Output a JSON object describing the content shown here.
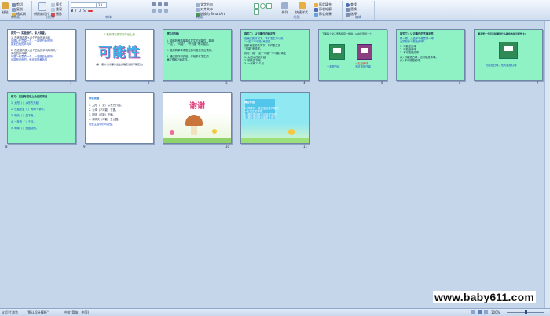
{
  "ribbon": {
    "clipboard_paste": "粘贴",
    "clipboard_items": [
      "剪切",
      "复制",
      "格式刷"
    ],
    "slides_new": "新建幻灯片",
    "slides_items": [
      "版式",
      "重设",
      "删除"
    ],
    "font_name": "",
    "font_size": "24",
    "paragraph_items": [
      "文字方向",
      "对齐文本",
      "转换为 SmartArt"
    ],
    "drawing_arrange": "排列",
    "drawing_quick_styles": "快速样式",
    "drawing_items": [
      "形状填充",
      "形状轮廓",
      "形状效果"
    ],
    "editing_items": [
      "查找",
      "替换",
      "选择"
    ],
    "group_labels": [
      "剪贴板",
      "幻灯片",
      "字体",
      "段落",
      "绘图",
      "编辑"
    ]
  },
  "slides": [
    {
      "num": "1",
      "title": "探究一：实验操作，深入调查。",
      "lines": [
        "1. 在纸箱内放入几个白色的乒乓球",
        "问题1:任意摸一个，一定是白色的吗?",
        "摸到白色的乒乓球",
        "2. 在纸箱内放入几个白色的乒乓球和几个",
        "黄色的乒乓球",
        "问题2:任意摸一个，一定是白色的吗?",
        "可能是白色的，也可能是黄色的"
      ]
    },
    {
      "num": "2",
      "subtitle": "人教新课标数学四年级上册",
      "big": "可能性",
      "caption": "(第一课时:认识事件发生的确定性和不确定性)"
    },
    {
      "num": "3",
      "title": "学习目标",
      "lines": [
        "1. 能够判断简单事件发生的可能性，能用",
        "“一定”、“可能”、“不可能”等词描述。",
        "2. 能对简单事件发生的可能性作出预测。",
        "3. 通过操作和实验，体验事件发生的",
        "确定性和不确定性。"
      ]
    },
    {
      "num": "4",
      "title": "探究二：认识事件的确定性",
      "lines": [
        "在确定的情况下，事件发生可以用",
        "“一定”“不可能”来描述。",
        "在不确定的情况下，事件发生用",
        "“可能”来描述。",
        "练习：用“一定”“可能”“不可能”填空",
        "1. 太阳从西边升起",
        "2. 明天会下雨",
        "3. 一年有12个月"
      ]
    },
    {
      "num": "5",
      "title": "下面每个盒子里各装有一些球，从中任意摸一个，",
      "labels": [
        "一定是白球",
        "一定是黄球",
        "不可能是白球"
      ]
    },
    {
      "num": "6",
      "title": "探究三：认识事件的不确定性",
      "lines": [
        "想一想，从盒子中任意摸一球，",
        "会摸到什么颜色的球?",
        "1. 可能是白球",
        "2. 可能是黄球",
        "3. 不可能是红球",
        "(1) 可能是白球，也可能是黄球。",
        "(2) 不可能是红球。"
      ]
    },
    {
      "num": "7",
      "title": "摸手里一个乒乓球摸到什么颜色的球可能性大?",
      "lines": [
        "可能是白球，也可能是红球"
      ]
    },
    {
      "num": "8",
      "title": "练习：在括号里填上合适的词语",
      "lines": [
        "1. 太阳（ ）从东方升起。",
        "2. 在抽屉里（ ）有两个硬币。",
        "3. 明天（ ）会下雨。",
        "4. 一年有（ ）个月。",
        "5. 地球（ ）是运动的。"
      ]
    },
    {
      "num": "9",
      "title": "你说我填",
      "lines": [
        "1. 太阳（一定）从东方升起。",
        "2. 公鸡（不可能）下蛋。",
        "3. 明天（可能）下雨。",
        "4. 我明天（可能）去公园。",
        "说说生活中的可能性。"
      ]
    },
    {
      "num": "10",
      "title": "谢谢",
      "lines": []
    },
    {
      "num": "11",
      "title": "课后作业",
      "lines": [
        "1. 同学们，说说生活中有哪些",
        "一定发生的事情。",
        "2. 哪些事情是不可能发生的?",
        "3. 哪些事情是可能发生的?"
      ]
    }
  ],
  "status": {
    "slide_info": "幻灯片浏览",
    "theme": "\"默认设计模板\"",
    "lang": "中文(简体，中国)",
    "zoom": "100%"
  },
  "watermark": "www.baby611.com"
}
